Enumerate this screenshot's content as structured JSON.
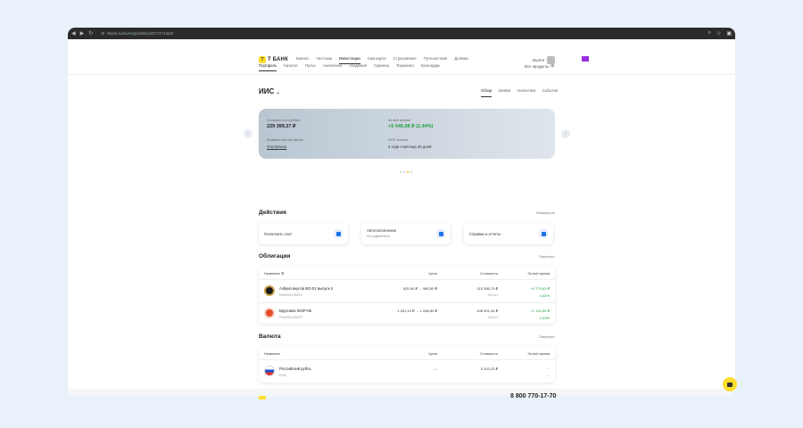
{
  "browser": {
    "url": "tbank.ru/invest/portfolio/2077274452/"
  },
  "header": {
    "logo": "Т БАНК",
    "nav": [
      "Бизнес",
      "Частным",
      "Инвестиции",
      "Сим-карта",
      "Страхование",
      "Путешествия",
      "Долями"
    ],
    "nav_active": 2,
    "login": "Выйти"
  },
  "subnav": {
    "items": [
      "Портфель",
      "Каталог",
      "Пульс",
      "Аналитика",
      "Академия",
      "Скринер",
      "Терминал",
      "Календарь"
    ],
    "active": 0,
    "all_products": "Все продукты"
  },
  "account": {
    "title": "ИИС",
    "tabs": [
      "Обзор",
      "Заявки",
      "Аналитика",
      "События"
    ],
    "active_tab": 0
  },
  "summary": {
    "value_label": "Стоимость в рублях",
    "value": "229 399,37 ₽",
    "profit_label": "За всё время",
    "profit": "+5 445,08 ₽ (2,44%)",
    "portfolio_label": "Модельный портфель",
    "portfolio_value": "Отключено",
    "term_label": "ИИС открыт",
    "term_value": "4 года 4 месяца 26 дней"
  },
  "actions": {
    "title": "Действия",
    "link": "Развернуть",
    "items": [
      {
        "label": "Пополнить счет",
        "sub": ""
      },
      {
        "label": "Автопополнение",
        "sub": "Не подключено"
      },
      {
        "label": "Справки и отчеты",
        "sub": ""
      }
    ]
  },
  "bonds": {
    "title": "Облигации",
    "link": "Свернуть",
    "columns": [
      "Название",
      "Цена",
      "Стоимость",
      "За всё время"
    ],
    "rows": [
      {
        "name": "Азбука вкусов БО-01 выпуск 4",
        "isin": "RU000A105Z13",
        "price": "920,50 ₽ → 980,50 ₽",
        "value": "115 395,70 ₽",
        "qty": "120 шт",
        "change": "+4 775,83 ₽",
        "pct": "4,32%"
      },
      {
        "name": "Брусника 002Р-05",
        "isin": "RU000A106Z1P",
        "price": "1 001,10 ₽ → 1 006,80 ₽",
        "value": "108 901,44 ₽",
        "qty": "108 шт",
        "change": "+1 109,59 ₽",
        "pct": "1,03%"
      }
    ]
  },
  "currency": {
    "title": "Валюта",
    "link": "Свернуть",
    "columns": [
      "Название",
      "Цена",
      "Стоимость",
      "За всё время"
    ],
    "rows": [
      {
        "name": "Российский рубль",
        "code": "RUB",
        "price": "—",
        "value": "5 102,23 ₽",
        "change": "—",
        "pct": "—"
      }
    ]
  },
  "footer": {
    "phone": "8 800 770-17-70"
  },
  "colors": {
    "accent": "#ffdd2d",
    "profit": "#1f9e3a",
    "link": "#1a73e8"
  }
}
